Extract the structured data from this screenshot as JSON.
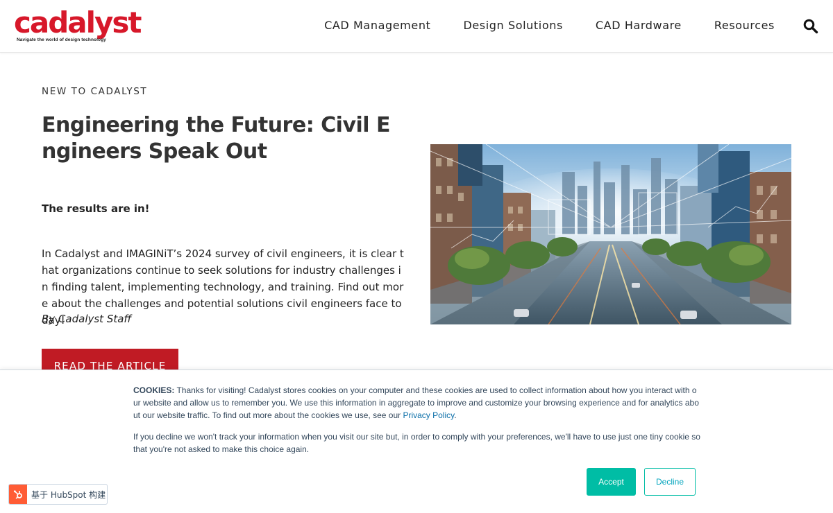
{
  "brand": {
    "name": "cadalyst",
    "tagline": "Navigate the world of design technology",
    "accent_color": "#d7182a"
  },
  "nav": {
    "items": [
      "CAD Management",
      "Design Solutions",
      "CAD Hardware",
      "Resources"
    ],
    "search_icon": "search-icon"
  },
  "article": {
    "eyebrow": "NEW TO CADALYST",
    "title": "Engineering the Future: Civil Engineers Speak Out",
    "lead": "The results are in!",
    "body": "In Cadalyst and IMAGINiT’s 2024 survey of civil engineers, it is clear that organizations continue to seek solutions for industry challenges in finding talent, implementing technology, and training. Find out more about the challenges and potential solutions civil engineers face today!",
    "byline": "By Cadalyst Staff",
    "cta": "READ THE ARTICLE",
    "cta_color": "#c01b24"
  },
  "cookie": {
    "label": "COOKIES:",
    "text": " Thanks for visiting! Cadalyst stores cookies on your computer and these cookies are used to collect information about how you interact with our website and allow us to remember you. We use this information in aggregate to improve and customize your browsing experience and for analytics about our website traffic. To find out more about the cookies we use, see our ",
    "link": "Privacy Policy",
    "text_end": ".",
    "text2": "If you decline we won't track your information when you visit our site but, in order to comply with your preferences, we'll have to use just one tiny cookie so that you're not asked to make this choice again.",
    "accept": "Accept",
    "decline": "Decline",
    "accent_color": "#00bda5"
  },
  "hubspot": {
    "label": "基于 HubSpot 构建",
    "color": "#ff5c35"
  }
}
